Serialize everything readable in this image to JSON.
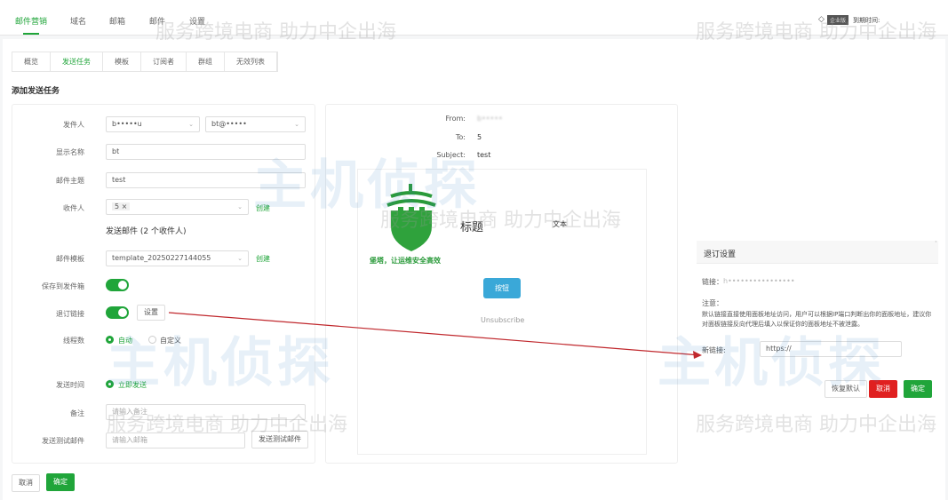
{
  "topnav": {
    "items": [
      "邮件营销",
      "域名",
      "邮箱",
      "邮件",
      "设置"
    ],
    "active": 0,
    "badge": "企业版",
    "expire_label": "到期时间:"
  },
  "tabs": {
    "items": [
      "概览",
      "发送任务",
      "模板",
      "订阅者",
      "群组",
      "无效列表"
    ],
    "active": 1
  },
  "page_title": "添加发送任务",
  "form": {
    "sender_label": "发件人",
    "sender_value": "b•••••u",
    "sender_email": "bt@•••••",
    "display_name_label": "显示名称",
    "display_name_value": "bt",
    "subject_label": "邮件主题",
    "subject_value": "test",
    "recipient_label": "收件人",
    "recipient_tag": "5",
    "create_link": "创建",
    "recipient_summary": "发送邮件 (2 个收件人)",
    "template_label": "邮件模板",
    "template_value": "template_20250227144055",
    "save_sent_label": "保存到发件箱",
    "save_sent_on": true,
    "unsub_label": "退订链接",
    "unsub_on": true,
    "settings_button": "设置",
    "threads_label": "线程数",
    "threads_auto": "自动",
    "threads_custom": "自定义",
    "send_time_label": "发送时间",
    "send_now": "立即发送",
    "remark_label": "备注",
    "remark_placeholder": "请输入备注",
    "test_label": "发送测试邮件",
    "test_placeholder": "请输入邮箱",
    "test_button": "发送测试邮件"
  },
  "footer": {
    "cancel": "取消",
    "confirm": "确定"
  },
  "preview": {
    "from_label": "From:",
    "from_value": "b•••••",
    "to_label": "To:",
    "to_value": "5",
    "subject_label": "Subject:",
    "subject_value": "test",
    "heading": "标题",
    "text": "文本",
    "slogan": "堡塔，让运维安全高效",
    "button": "按钮",
    "unsubscribe": "Unsubscribe"
  },
  "dialog": {
    "title": "退订设置",
    "link_label": "链接：",
    "link_value": "h••••••••••••••••",
    "note_label": "注意：",
    "note_text": "默认链接直接使用面板地址访问，用户可以根据IP端口判断出你的面板地址，建议你对面板链接反向代理后填入以保证你的面板地址不被泄露。",
    "new_link_label": "新链接:",
    "new_link_value": "https://",
    "reset": "恢复默认",
    "cancel": "取消",
    "confirm": "确定"
  },
  "watermark": {
    "text": "服务跨境电商  助力中企出海",
    "brand": "主机侦探"
  },
  "colors": {
    "accent": "#20a53a",
    "danger": "#e02020",
    "preview_button": "#3aa8d8"
  }
}
